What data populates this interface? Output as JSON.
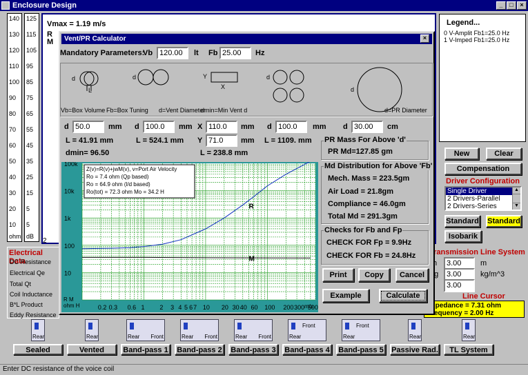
{
  "window": {
    "title": "Enclosure Design"
  },
  "scale_left": {
    "ticks": [
      "140",
      "130",
      "120",
      "110",
      "100",
      "90",
      "80",
      "70",
      "60",
      "50",
      "40",
      "30",
      "20",
      "10"
    ],
    "unit": "ohm"
  },
  "scale_right": {
    "ticks": [
      "125",
      "115",
      "105",
      "95",
      "85",
      "75",
      "65",
      "55",
      "45",
      "35",
      "25",
      "15",
      "5",
      "5"
    ],
    "unit": "dB"
  },
  "graph": {
    "vmax": "Vmax = 1.19 m/s",
    "r_label": "R",
    "m_label": "M",
    "x_left": "2",
    "x_right": "Hz"
  },
  "legend": {
    "title": "Legend...",
    "items": [
      "0 V-Amplit Fb1=25.0 Hz",
      "1 V-Imped Fb1=25.0 Hz"
    ]
  },
  "right_panel": {
    "new": "New",
    "clear": "Clear",
    "compensation": "Compensation",
    "driver_config_title": "Driver Configuration",
    "driver_options": [
      "Single Driver",
      "2 Drivers-Parallel",
      "2 Drivers-Series"
    ],
    "standard1": "Standard",
    "standard2": "Standard",
    "isobarik": "Isobarik",
    "tl_title": "Transmission Line System",
    "tl_rows": [
      {
        "prefix": "h",
        "value": "3.00",
        "unit": "m"
      },
      {
        "prefix": "ng",
        "value": "3.00",
        "unit": "kg/m^3"
      },
      {
        "prefix": "",
        "value": "3.00",
        "unit": ""
      }
    ],
    "line_cursor_title": "Line Cursor",
    "impedance": "Impedance = 7.31 ohm",
    "frequency": "Frequency = 2.00 Hz"
  },
  "electrical": {
    "title": "Electrical Data",
    "rows": [
      "DC Resistance",
      "Electrical Qe",
      "Total Qt",
      "Coil Inductance",
      "B*L Product",
      "Eddy Resistance"
    ]
  },
  "toolbar": {
    "buttons": [
      "Sealed",
      "Vented",
      "Band-pass 1",
      "Band-pass 2",
      "Band-pass 3",
      "Band-pass 4",
      "Band-pass 5",
      "Passive Rad.",
      "TL System"
    ],
    "rear": "Rear",
    "front": "Front"
  },
  "status": {
    "text": "Enter DC resistance of the voice coil"
  },
  "dialog": {
    "title": "Vent/PR Calculator",
    "mandatory": "Mandatory Parameters:",
    "vb_label": "Vb",
    "vb_value": "120.00",
    "vb_unit": "lt",
    "fb_label": "Fb",
    "fb_value": "25.00",
    "fb_unit": "Hz",
    "diagram_captions": [
      "Vb=Box Volume",
      "Fb=Box Tuning",
      "d=Vent Diameter",
      "dmin=Min Vent d",
      "d=PR Diameter"
    ],
    "diag_d": "d",
    "diag_L": "L",
    "diag_Y": "Y",
    "diag_X": "X",
    "vents": [
      {
        "sym": "d",
        "value": "50.0",
        "unit": "mm",
        "L": "L = 41.91 mm"
      },
      {
        "sym": "d",
        "value": "100.0",
        "unit": "mm",
        "L": "L = 524.1 mm"
      },
      {
        "sym": "X",
        "value": "110.0",
        "unit": "mm",
        "L": ""
      },
      {
        "sym": "d",
        "value": "100.0",
        "unit": "mm",
        "L": "L = 1109. mm"
      },
      {
        "sym": "d",
        "value": "30.00",
        "unit": "cm",
        "L": ""
      }
    ],
    "rect_y": {
      "sym": "Y",
      "value": "71.0",
      "unit": "mm"
    },
    "rect_L": "L = 238.8 mm",
    "dmin": "dmin= 96.50",
    "pr_title": "PR Mass For Above 'd'",
    "pr_md": "PR Md=127.85 gm",
    "md_title": "Md Distribution for Above 'Fb'",
    "mech_mass": "Mech. Mass = 223.5gm",
    "air_load": "Air Load = 21.8gm",
    "compliance": "Compliance = 46.0gm",
    "total_md": "Total Md = 291.3gm",
    "checks_title": "Checks for Fb and Fp",
    "check_fp": "CHECK FOR Fp = 9.9Hz",
    "check_fb": "CHECK FOR Fb = 24.8Hz",
    "print": "Print",
    "copy": "Copy",
    "cancel": "Cancel",
    "example": "Example",
    "calculate": "Calculate",
    "chart_info": [
      "Z(v)=R(v)+jwM(v), v=Port Air Velocity",
      "Ro = 7.4 ohm (Qp based)",
      "Ro = 64.9 ohm (l/d based)",
      "Ro(tot) = 72.3 ohm       Mo = 34.2 H"
    ],
    "chart_r": "R",
    "chart_m": "M",
    "chart_corner_top": "R   M",
    "chart_corner_bot": "ohm H",
    "chart_unit": "m/s"
  },
  "chart_data": {
    "type": "line",
    "ytick_labels": [
      "100k",
      "10k",
      "1k",
      "100",
      "10"
    ],
    "xtick_labels": [
      "0.2",
      "0.3",
      "0.6",
      "1",
      "2",
      "3",
      "4",
      "5",
      "6",
      "7",
      "10",
      "20",
      "30",
      "40",
      "60",
      "100",
      "200",
      "300",
      "500"
    ],
    "xlabel": "m/s",
    "series": [
      {
        "name": "R",
        "x": [
          0.1,
          0.3,
          0.6,
          1,
          2,
          4,
          10,
          20,
          40,
          60,
          100,
          200,
          500
        ],
        "y": [
          75,
          78,
          82,
          90,
          110,
          160,
          400,
          1000,
          3000,
          6000,
          15000,
          40000,
          120000
        ]
      },
      {
        "name": "M",
        "x": [
          0.1,
          1,
          10,
          100,
          500
        ],
        "y": [
          36,
          36,
          35,
          34.6,
          34.3
        ]
      }
    ],
    "xlim": [
      0.1,
      600
    ],
    "ylim": [
      1,
      100000
    ],
    "yscale": "log",
    "xscale": "log",
    "colors": {
      "R": "#1030c0",
      "M": "#000000",
      "background": "#2a9898",
      "plot": "#ffffff"
    }
  }
}
